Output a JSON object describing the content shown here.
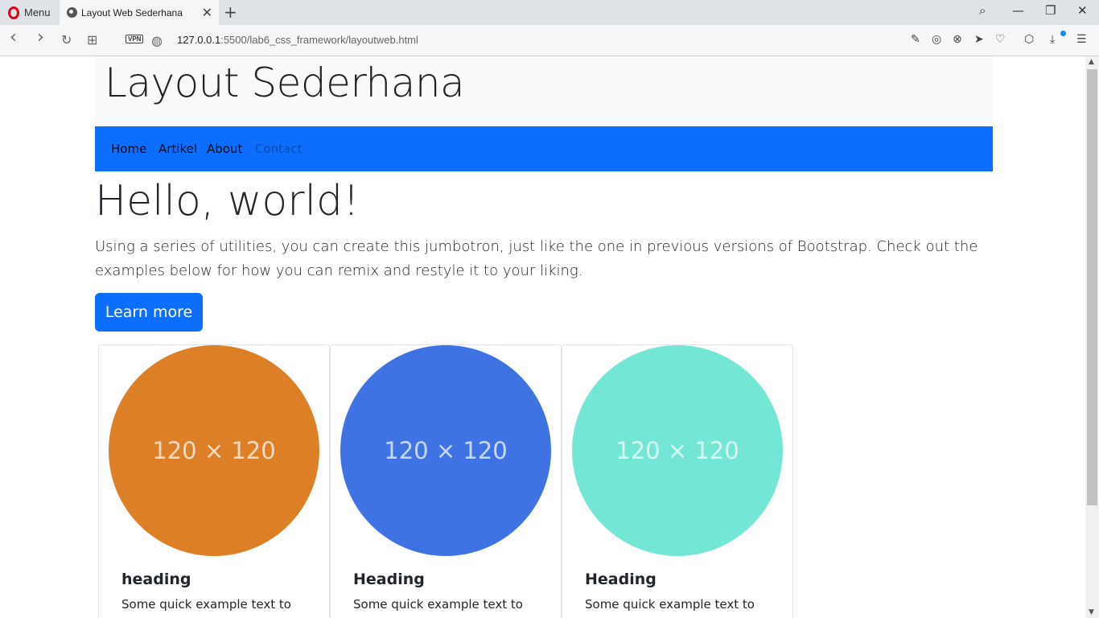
{
  "browser": {
    "menu_label": "Menu",
    "tab_title": "Layout Web Sederhana",
    "tab_close": "✕",
    "new_tab": "+",
    "vpn_label": "VPN",
    "url_host": "127.0.0.1",
    "url_rest": ":5500/lab6_css_framework/layoutweb.html",
    "icons": {
      "search": "⌕",
      "minimize": "—",
      "restore": "❐",
      "close": "✕",
      "back": "‹",
      "forward": "›",
      "reload": "↻",
      "tabs": "⊞",
      "snapshot": "◎",
      "adblock": "⊗",
      "send": "➤",
      "heart": "♡",
      "box": "⬡",
      "download": "⤓",
      "settings": "☰",
      "edit": "✎"
    }
  },
  "header": {
    "title": "Layout Sederhana"
  },
  "nav": {
    "items": [
      {
        "label": "Home"
      },
      {
        "label": "Artikel"
      },
      {
        "label": "About"
      },
      {
        "label": "Contact"
      }
    ]
  },
  "hero": {
    "title": "Hello, world!",
    "text": "Using a series of utilities, you can create this jumbotron, just like the one in previous versions of Bootstrap. Check out the examples below for how you can remix and restyle it to your liking.",
    "button": "Learn more"
  },
  "cards": [
    {
      "placeholder": "120 × 120",
      "color": "#dc7f27",
      "title": "heading",
      "text": "Some quick example text to"
    },
    {
      "placeholder": "120 × 120",
      "color": "#3f73e3",
      "title": "Heading",
      "text": "Some quick example text to"
    },
    {
      "placeholder": "120 × 120",
      "color": "#74e6d6",
      "title": "Heading",
      "text": "Some quick example text to"
    }
  ],
  "colors": {
    "navbar": "#0d6efd",
    "header_bg": "#f8f9fa",
    "button": "#0d6efd"
  }
}
